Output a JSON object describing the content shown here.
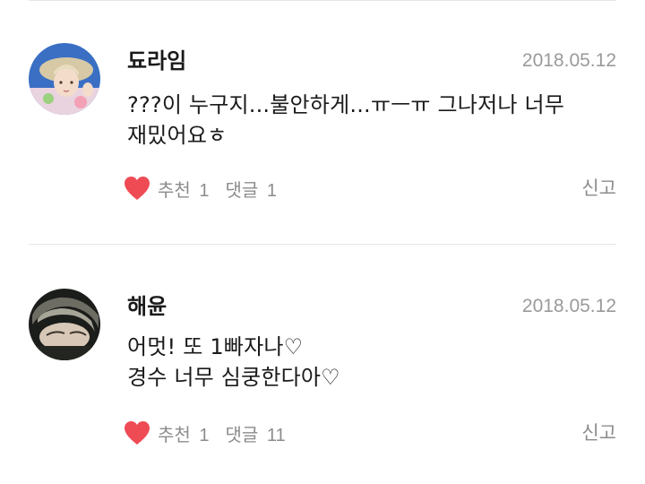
{
  "comments": [
    {
      "author": "됴라임",
      "date": "2018.05.12",
      "text": "???이 누구지...불안하게...ㅠㅡㅠ 그나저나 너무\n재밌어요ㅎ",
      "like_label": "추천",
      "like_count": "1",
      "reply_label": "댓글",
      "reply_count": "1",
      "report_label": "신고",
      "avatar": "avatar-photo-hat"
    },
    {
      "author": "해윤",
      "date": "2018.05.12",
      "text": "어멋! 또 1빠자나♡\n경수 너무 심쿵한다아♡",
      "like_label": "추천",
      "like_count": "1",
      "reply_label": "댓글",
      "reply_count": "11",
      "report_label": "신고",
      "avatar": "avatar-photo-dark"
    }
  ],
  "colors": {
    "heart": "#ef4b55",
    "meta_text": "#8c8c8c",
    "date_text": "#9a9a9a",
    "divider": "#e6e6e6"
  }
}
